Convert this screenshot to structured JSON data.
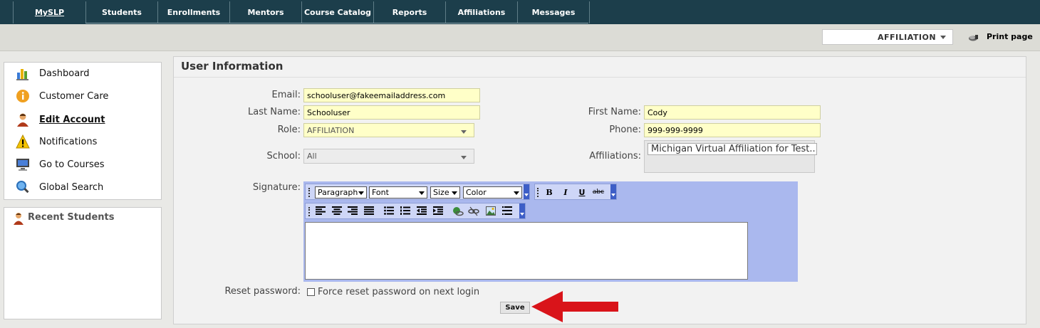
{
  "nav": {
    "tabs": [
      "MySLP",
      "Students",
      "Enrollments",
      "Mentors",
      "Course Catalog",
      "Reports",
      "Affiliations",
      "Messages"
    ],
    "active_tab": "MySLP"
  },
  "subbar": {
    "affiliation_select": "AFFILIATION",
    "print_label": "Print page"
  },
  "sidebar": {
    "items": [
      {
        "label": "Dashboard",
        "icon": "chart-icon"
      },
      {
        "label": "Customer Care",
        "icon": "info-icon"
      },
      {
        "label": "Edit Account",
        "icon": "user-icon"
      },
      {
        "label": "Notifications",
        "icon": "warning-icon"
      },
      {
        "label": "Go to Courses",
        "icon": "monitor-icon"
      },
      {
        "label": "Global Search",
        "icon": "search-icon"
      }
    ],
    "recent_title": "Recent Students"
  },
  "form": {
    "title": "User Information",
    "email_label": "Email:",
    "email_value": "schooluser@fakeemailaddress.com",
    "last_name_label": "Last Name:",
    "last_name_value": "Schooluser",
    "first_name_label": "First Name:",
    "first_name_value": "Cody",
    "role_label": "Role:",
    "role_value": "AFFILIATION",
    "phone_label": "Phone:",
    "phone_value": "999-999-9999",
    "school_label": "School:",
    "school_value": "All",
    "affiliations_label": "Affiliations:",
    "affiliations_value": "Michigan Virtual Affiliation for Test...",
    "signature_label": "Signature:",
    "reset_label": "Reset password:",
    "reset_checkbox_label": "Force reset password on next login",
    "save_label": "Save"
  },
  "editor": {
    "paragraph": "Paragraph",
    "font": "Font",
    "size": "Size",
    "color": "Color",
    "bold": "B",
    "italic": "I",
    "underline": "U",
    "strike": "abc"
  },
  "colors": {
    "nav_bg": "#1c3e4b",
    "field_bg": "#ffffc8",
    "editor_bg": "#aab8ee",
    "arrow": "#d9141a"
  }
}
